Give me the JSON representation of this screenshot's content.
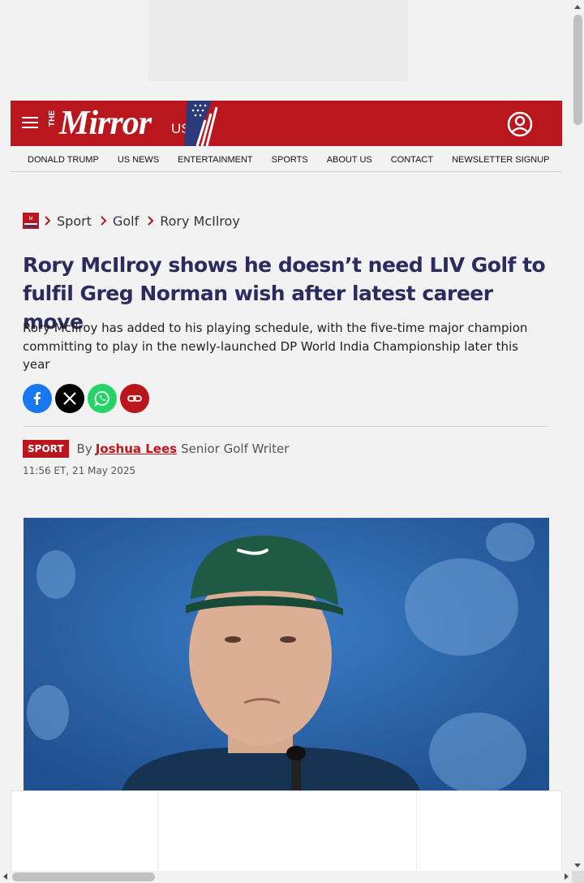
{
  "site": {
    "logo_the": "THE",
    "logo_name": "Mirror",
    "logo_suffix": "US"
  },
  "nav": {
    "items": [
      {
        "label": "DONALD TRUMP"
      },
      {
        "label": "US NEWS"
      },
      {
        "label": "ENTERTAINMENT"
      },
      {
        "label": "SPORTS"
      },
      {
        "label": "ABOUT US"
      },
      {
        "label": "CONTACT"
      },
      {
        "label": "NEWSLETTER SIGNUP"
      }
    ]
  },
  "breadcrumb": {
    "items": [
      {
        "label": "Sport"
      },
      {
        "label": "Golf"
      },
      {
        "label": "Rory McIlroy"
      }
    ]
  },
  "article": {
    "headline": "Rory McIlroy shows he doesn’t need LIV Golf to fulfil Greg Norman wish after latest career move",
    "standfirst": "Rory McIlroy has added to his playing schedule, with the five-time major champion committing to play in the newly-launched DP World India Championship later this year",
    "section_badge": "SPORT",
    "by_prefix": "By",
    "author": "Joshua Lees",
    "author_role": "Senior Golf Writer",
    "timestamp": "11:56 ET, 21 May 2025"
  },
  "colors": {
    "brand_red": "#b9161d",
    "headline_navy": "#2b2b5e",
    "facebook": "#1877f2",
    "x": "#000000",
    "whatsapp": "#25d366"
  },
  "icons": {
    "menu": "hamburger-icon",
    "account": "account-icon",
    "share": [
      "facebook-icon",
      "x-icon",
      "whatsapp-icon",
      "copy-link-icon"
    ]
  }
}
